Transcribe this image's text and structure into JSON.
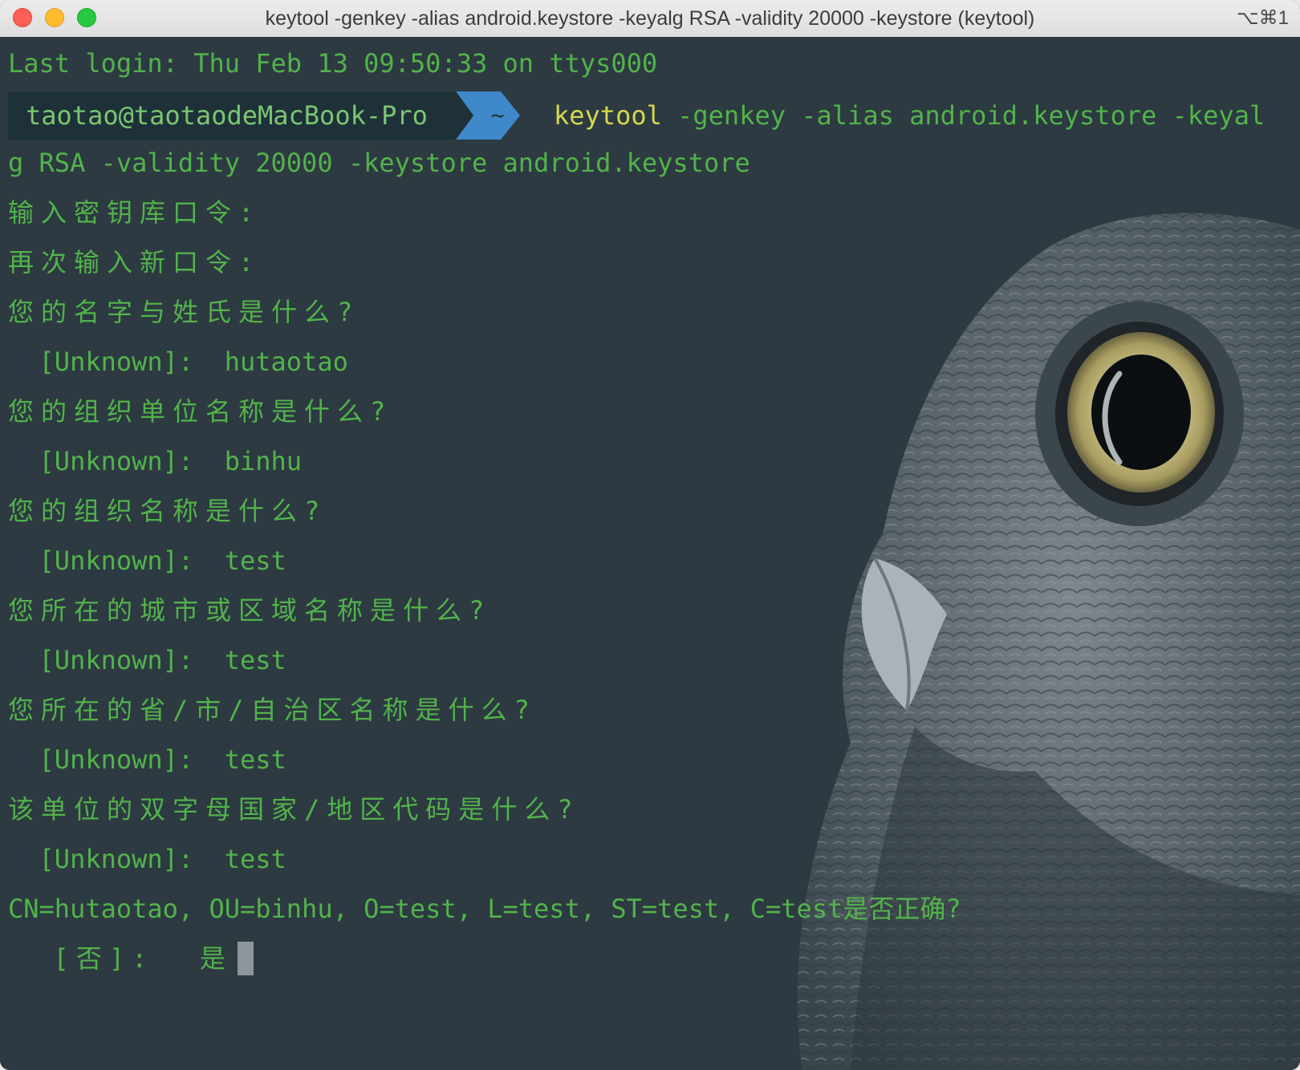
{
  "window": {
    "title": "keytool -genkey -alias android.keystore -keyalg RSA -validity 20000 -keystore (keytool)",
    "shortcut": "⌥⌘1"
  },
  "colors": {
    "background": "#2d3a42",
    "text_green": "#52b34a",
    "command_yellow": "#d6d84e",
    "prompt_user_bg": "#1e3138",
    "prompt_dir_bg": "#3f88c9"
  },
  "terminal": {
    "last_login": "Last login: Thu Feb 13 09:50:33 on ttys000",
    "prompt": {
      "user_host": "taotao@taotaodeMacBook-Pro",
      "dir": "~"
    },
    "command": {
      "program": "keytool",
      "args_first": " -genkey -alias android.keystore -keyal",
      "args_wrap": "g RSA -validity 20000 -keystore android.keystore"
    },
    "lines": [
      "输入密钥库口令:",
      "再次输入新口令:",
      "您的名字与姓氏是什么?",
      "  [Unknown]:  hutaotao",
      "您的组织单位名称是什么?",
      "  [Unknown]:  binhu",
      "您的组织名称是什么?",
      "  [Unknown]:  test",
      "您所在的城市或区域名称是什么?",
      "  [Unknown]:  test",
      "您所在的省/市/自治区名称是什么?",
      "  [Unknown]:  test",
      "该单位的双字母国家/地区代码是什么?",
      "  [Unknown]:  test",
      "CN=hutaotao, OU=binhu, O=test, L=test, ST=test, C=test是否正确?"
    ],
    "final_prompt": "  [否]:  是"
  }
}
